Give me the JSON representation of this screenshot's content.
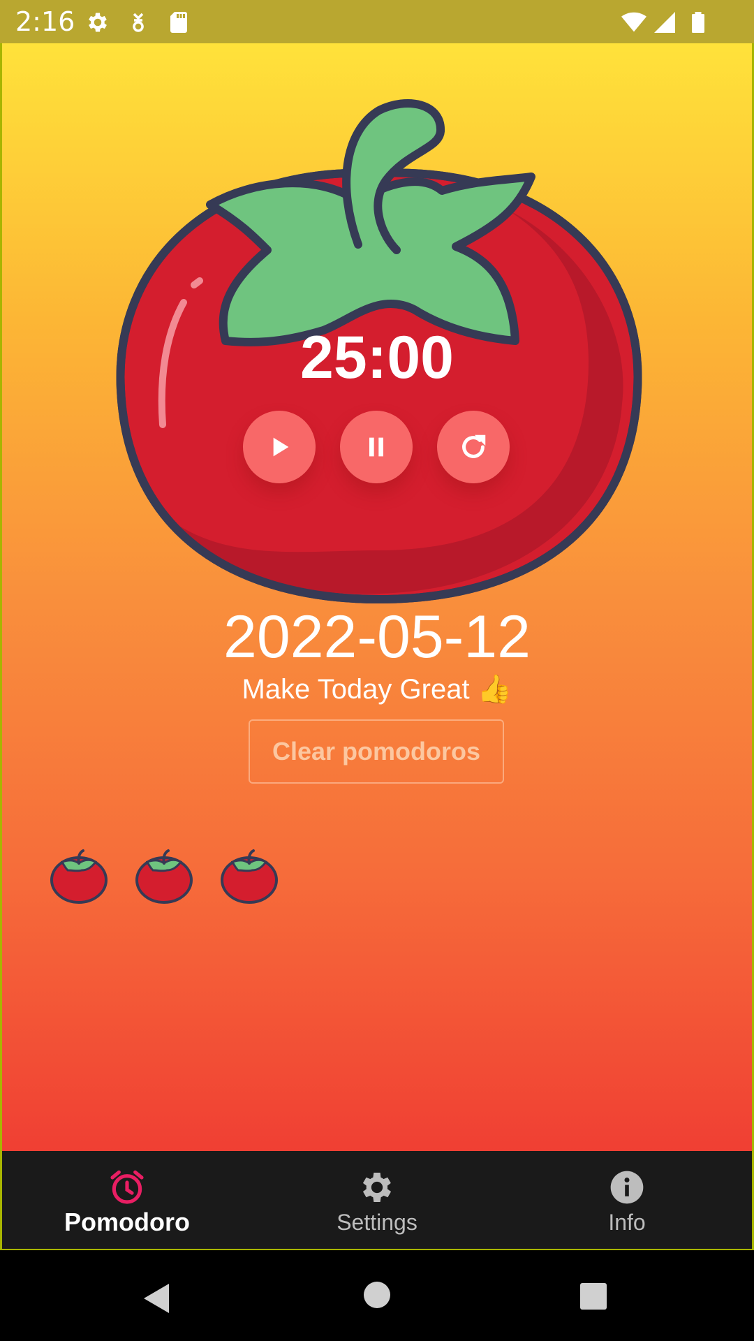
{
  "status_bar": {
    "time": "2:16",
    "icons": [
      "gear-icon",
      "download-notification-icon",
      "sd-card-icon",
      "wifi-icon",
      "cell-signal-icon",
      "battery-icon"
    ]
  },
  "timer": {
    "display": "25:00",
    "controls": [
      "play-icon",
      "pause-icon",
      "reset-icon"
    ]
  },
  "date": "2022-05-12",
  "motto": "Make Today Great 👍",
  "clear_button": "Clear pomodoros",
  "pomodoro_count": 3,
  "bottom_nav": {
    "items": [
      {
        "label": "Pomodoro",
        "icon": "alarm-clock-icon",
        "active": true
      },
      {
        "label": "Settings",
        "icon": "gear-icon",
        "active": false
      },
      {
        "label": "Info",
        "icon": "info-icon",
        "active": false
      }
    ]
  },
  "colors": {
    "accent": "#e91e63",
    "tomato_red": "#d41e2e",
    "leaf_green": "#6fc47f",
    "button_bg": "#f86868"
  }
}
